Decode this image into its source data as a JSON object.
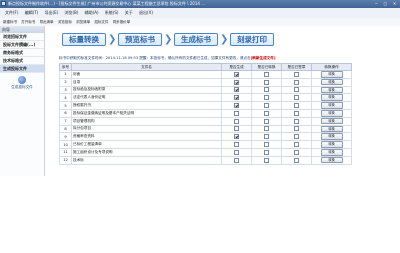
{
  "titlebar": {
    "text": "新点投标文件制作软件(...)  -  [投标文件生成] 广州市公共资源交易中心 某某工程施工总承包 投标文件 \\ 2014 ...",
    "min": "─",
    "max": "□",
    "close": "✕"
  },
  "menubar": [
    "文件(F)",
    "编辑(T)",
    "导出(E)",
    "浏览(B)",
    "辅助(A)",
    "系统(S)",
    "关于",
    "退出(X)"
  ],
  "toolbar": [
    "新建标书",
    "打开标书",
    "导出清单",
    "浏览投标",
    "浏览清单",
    "招标文件",
    "同步报价单"
  ],
  "sidebar": {
    "header": "向导",
    "items": [
      "浏览招标文件",
      "投标文件撰编(...)",
      "商务标格式",
      "技术标格式",
      "生成投标文件"
    ],
    "active_index": 4,
    "sub_label": "生成投标文件"
  },
  "steps": [
    "标量转换",
    "预览标书",
    "生成标书",
    "刻录打印"
  ],
  "note": {
    "prefix": "标书中获取的标准文件时间：2014-11-18 09:53  提醒：",
    "body": "本投标书，确认所有的文件都已生成，如果文件有更改，请点击",
    "link": "[刷新生成文件]"
  },
  "table": {
    "headers": [
      "序号",
      "文件名",
      "是否生成",
      "是否已转换",
      "是否已签章",
      "转换操作"
    ],
    "action_label": "转换",
    "rows": [
      {
        "no": "1",
        "name": "封面",
        "gen": true,
        "conv": false,
        "sign": false
      },
      {
        "no": "2",
        "name": "目录",
        "gen": true,
        "conv": false,
        "sign": false
      },
      {
        "no": "3",
        "name": "投标函及投标函附录",
        "gen": true,
        "conv": false,
        "sign": false
      },
      {
        "no": "4",
        "name": "法定代表人身份证明",
        "gen": true,
        "conv": false,
        "sign": false
      },
      {
        "no": "5",
        "name": "授权委托书",
        "gen": true,
        "conv": false,
        "sign": false
      },
      {
        "no": "6",
        "name": "投标保证金缴纳证明及基本户相关证明",
        "gen": false,
        "conv": false,
        "sign": false
      },
      {
        "no": "7",
        "name": "项目管理机构",
        "gen": false,
        "conv": false,
        "sign": false
      },
      {
        "no": "8",
        "name": "拟分包项目",
        "gen": false,
        "conv": false,
        "sign": false
      },
      {
        "no": "9",
        "name": "资格审查资料",
        "gen": true,
        "conv": false,
        "sign": false
      },
      {
        "no": "10",
        "name": "已标价工程量清单",
        "gen": false,
        "conv": false,
        "sign": false
      },
      {
        "no": "11",
        "name": "施工组织设计及专项说明",
        "gen": false,
        "conv": false,
        "sign": false
      },
      {
        "no": "12",
        "name": "技术标",
        "gen": false,
        "conv": false,
        "sign": false
      }
    ]
  }
}
